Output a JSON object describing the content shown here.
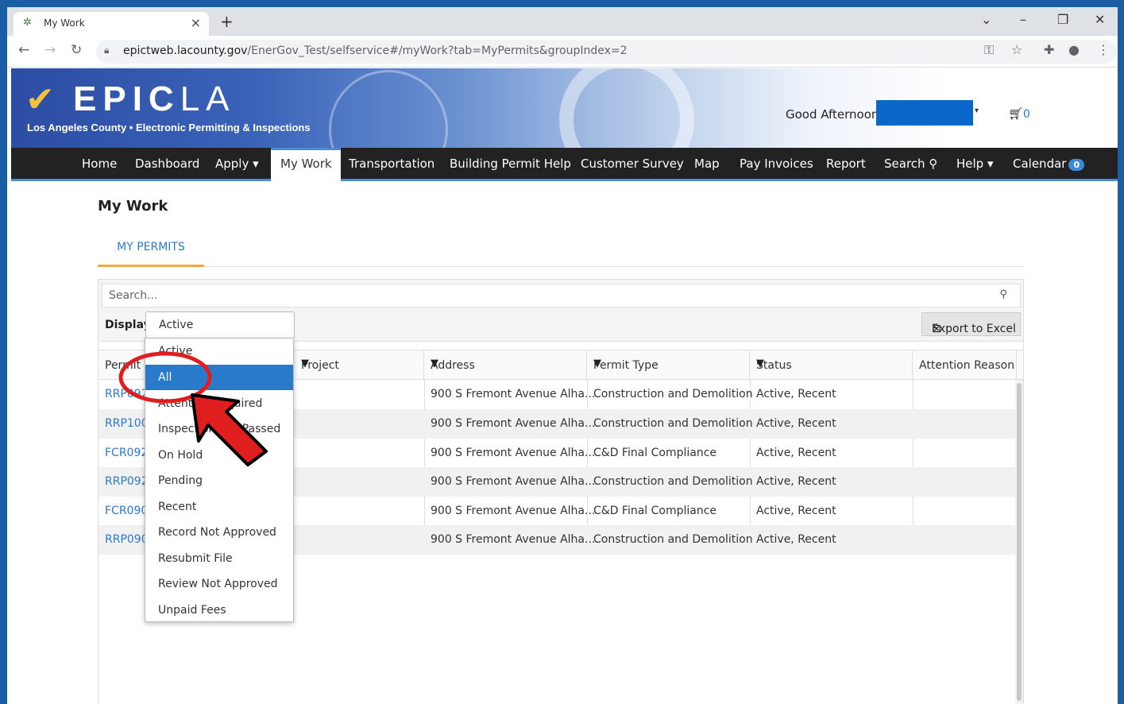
{
  "browser": {
    "tab_title": "My Work",
    "url_host": "epictweb.lacounty.gov",
    "url_path": "/EnerGov_Test/selfservice#/myWork?tab=MyPermits&groupIndex=2"
  },
  "banner": {
    "logo_main": "EPIC",
    "logo_thin": "LA",
    "logo_sub": "Los Angeles County • Electronic Permitting & Inspections",
    "greeting": "Good Afternoon,",
    "cart_count": "0"
  },
  "nav": {
    "home": "Home",
    "dashboard": "Dashboard",
    "apply": "Apply ▾",
    "my_work": "My Work",
    "transportation": "Transportation",
    "building_help": "Building Permit Help",
    "survey": "Customer Survey",
    "map": "Map",
    "pay": "Pay Invoices",
    "report": "Report",
    "search": "Search",
    "help": "Help ▾",
    "calendar": "Calendar",
    "calendar_count": "0"
  },
  "page": {
    "title": "My Work",
    "tab": "MY PERMITS"
  },
  "grid": {
    "search_placeholder": "Search...",
    "display_label": "Display",
    "display_value": "Active",
    "export_label": "Export to Excel",
    "columns": [
      "Permit #",
      "Project",
      "Address",
      "Permit Type",
      "Status",
      "Attention Reason"
    ],
    "rows": [
      {
        "id": "RRP0920",
        "address": "900 S Fremont Avenue Alha...",
        "type": "Construction and Demolition",
        "status": "Active, Recent"
      },
      {
        "id": "RRP1000",
        "address": "900 S Fremont Avenue Alha...",
        "type": "Construction and Demolition",
        "status": "Active, Recent"
      },
      {
        "id": "FCR0920",
        "address": "900 S Fremont Avenue Alha...",
        "type": "C&D Final Compliance",
        "status": "Active, Recent"
      },
      {
        "id": "RRP0920",
        "address": "900 S Fremont Avenue Alha...",
        "type": "Construction and Demolition",
        "status": "Active, Recent"
      },
      {
        "id": "FCR0900",
        "address": "900 S Fremont Avenue Alha...",
        "type": "C&D Final Compliance",
        "status": "Active, Recent"
      },
      {
        "id": "RRP0900",
        "address": "900 S Fremont Avenue Alha...",
        "type": "Construction and Demolition",
        "status": "Active, Recent"
      }
    ]
  },
  "dropdown": {
    "options": [
      "Active",
      "All",
      "Attention Required",
      "Inspection Not Passed",
      "On Hold",
      "Pending",
      "Recent",
      "Record Not Approved",
      "Resubmit File",
      "Review Not Approved",
      "Unpaid Fees"
    ],
    "selected": "All"
  },
  "colors": {
    "accent": "#2a7acb",
    "nav_bg": "#222222",
    "tab_underline": "#f0a845",
    "annotation": "#e01e1e"
  }
}
